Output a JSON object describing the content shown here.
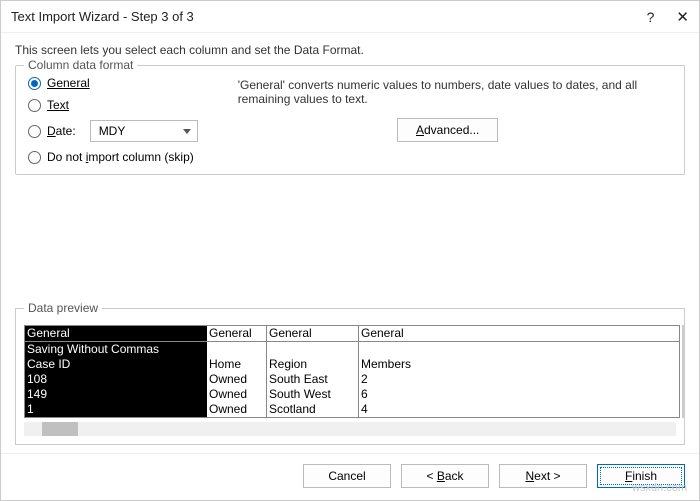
{
  "title": "Text Import Wizard - Step 3 of 3",
  "intro": "This screen lets you select each column and set the Data Format.",
  "format": {
    "legend": "Column data format",
    "general": "General",
    "text": "Text",
    "date_prefix": "D",
    "date_rest": "ate:",
    "date_format": "MDY",
    "skip_prefix": "Do not ",
    "skip_u": "i",
    "skip_rest": "mport column (skip)"
  },
  "description": "'General' converts numeric values to numbers, date values to dates, and all remaining values to text.",
  "advanced_u": "A",
  "advanced_rest": "dvanced...",
  "preview_legend": "Data preview",
  "headers": {
    "c0": "General",
    "c1": "General",
    "c2": "General",
    "c3": "General"
  },
  "rows": [
    {
      "c0": "Saving Without Commas",
      "c1": "",
      "c2": "",
      "c3": ""
    },
    {
      "c0": "",
      "c1": "",
      "c2": "",
      "c3": ""
    },
    {
      "c0": "Case ID",
      "c1": "Home",
      "c2": "Region",
      "c3": "Members"
    },
    {
      "c0": "108",
      "c1": "Owned",
      "c2": "South East",
      "c3": "2"
    },
    {
      "c0": "149",
      "c1": "Owned",
      "c2": "South West",
      "c3": "6"
    },
    {
      "c0": "1",
      "c1": "Owned",
      "c2": "Scotland",
      "c3": "4"
    }
  ],
  "buttons": {
    "cancel": "Cancel",
    "back_u": "B",
    "back_rest": "ack",
    "next_u": "N",
    "next_rest": "ext >",
    "finish_u": "F",
    "finish_rest": "inish"
  },
  "watermark": "wsxdn.com"
}
